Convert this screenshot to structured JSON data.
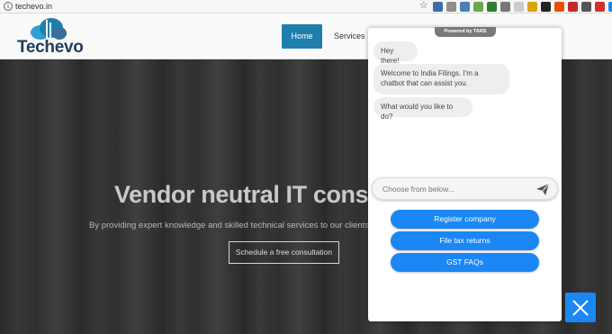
{
  "browser": {
    "url": "techevo.in",
    "info_icon": "i",
    "star_icon": "☆"
  },
  "extensions": [
    {
      "name": "ext-icon-1",
      "color": "#3a6ea5"
    },
    {
      "name": "ext-icon-2",
      "color": "#8e8e8e"
    },
    {
      "name": "ext-icon-3",
      "color": "#4a7fb8"
    },
    {
      "name": "ext-icon-4",
      "color": "#6aa84f"
    },
    {
      "name": "ext-icon-5",
      "color": "#2e7d32"
    },
    {
      "name": "ext-icon-6",
      "color": "#777777"
    },
    {
      "name": "ext-icon-7",
      "color": "#cccccc"
    },
    {
      "name": "ext-icon-8",
      "color": "#d9a400"
    },
    {
      "name": "ext-icon-9",
      "color": "#222222"
    },
    {
      "name": "ext-icon-10",
      "color": "#e65100"
    },
    {
      "name": "ext-icon-11",
      "color": "#c62828"
    },
    {
      "name": "ext-icon-12",
      "color": "#555555"
    },
    {
      "name": "ext-icon-13",
      "color": "#d32f2f"
    },
    {
      "name": "ext-icon-14",
      "color": "#1e88e5"
    }
  ],
  "site": {
    "logo_text": "Techevo",
    "nav": {
      "home": "Home",
      "services": "Services"
    },
    "hero": {
      "title": "Vendor neutral IT cons",
      "subtitle": "By providing expert knowledge and skilled technical services to our clients, w",
      "cta": "Schedule a free consultation"
    }
  },
  "chat": {
    "powered_by": "Powered by TARS",
    "messages": [
      "Hey there!",
      "Welcome to India Filings. I'm a chatbot that can assist you.",
      "What would you like to do?"
    ],
    "input_placeholder": "Choose from below...",
    "options": [
      "Register company",
      "File tax returns",
      "GST FAQs"
    ]
  },
  "colors": {
    "accent": "#1a87f5",
    "nav_active": "#1e7fae",
    "logo": "#1f3c5c"
  }
}
